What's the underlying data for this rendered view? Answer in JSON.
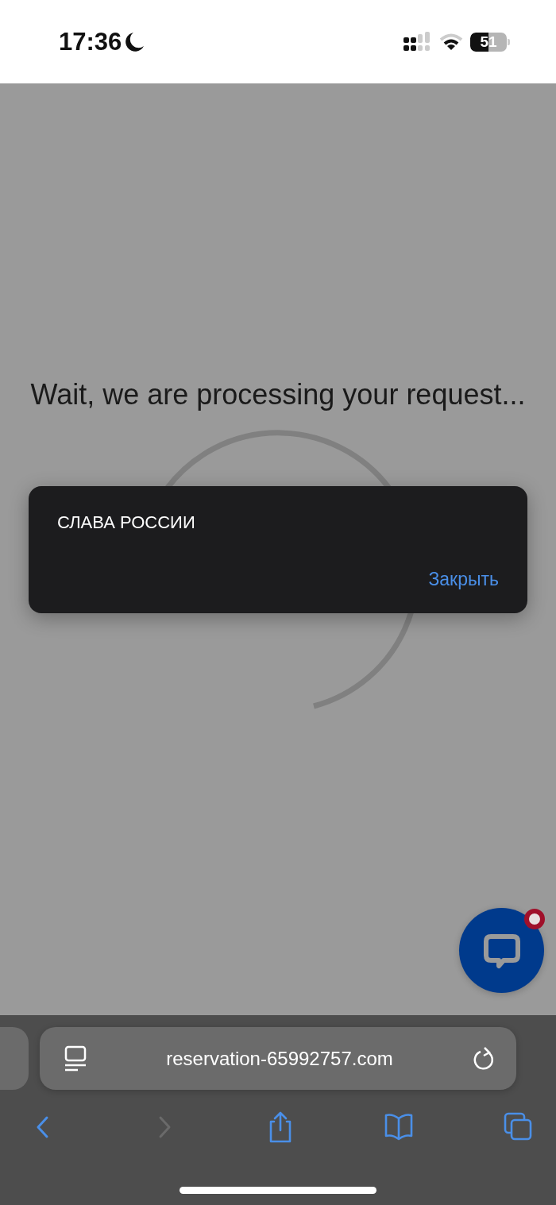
{
  "status_bar": {
    "time": "17:36",
    "focus_moon": true,
    "battery": "51"
  },
  "page": {
    "message": "Wait, we are processing your request...",
    "spinner": true
  },
  "alert": {
    "message": "СЛАВА РОССИИ",
    "button": "Закрыть"
  },
  "chat_button": {
    "badge": true
  },
  "address_bar": {
    "url": "reservation-65992757.com"
  },
  "toolbar": [
    {
      "kind": "back",
      "disabled": false
    },
    {
      "kind": "forward",
      "disabled": true
    },
    {
      "kind": "share",
      "disabled": false
    },
    {
      "kind": "bookmarks",
      "disabled": false
    },
    {
      "kind": "tabs",
      "disabled": false
    }
  ]
}
